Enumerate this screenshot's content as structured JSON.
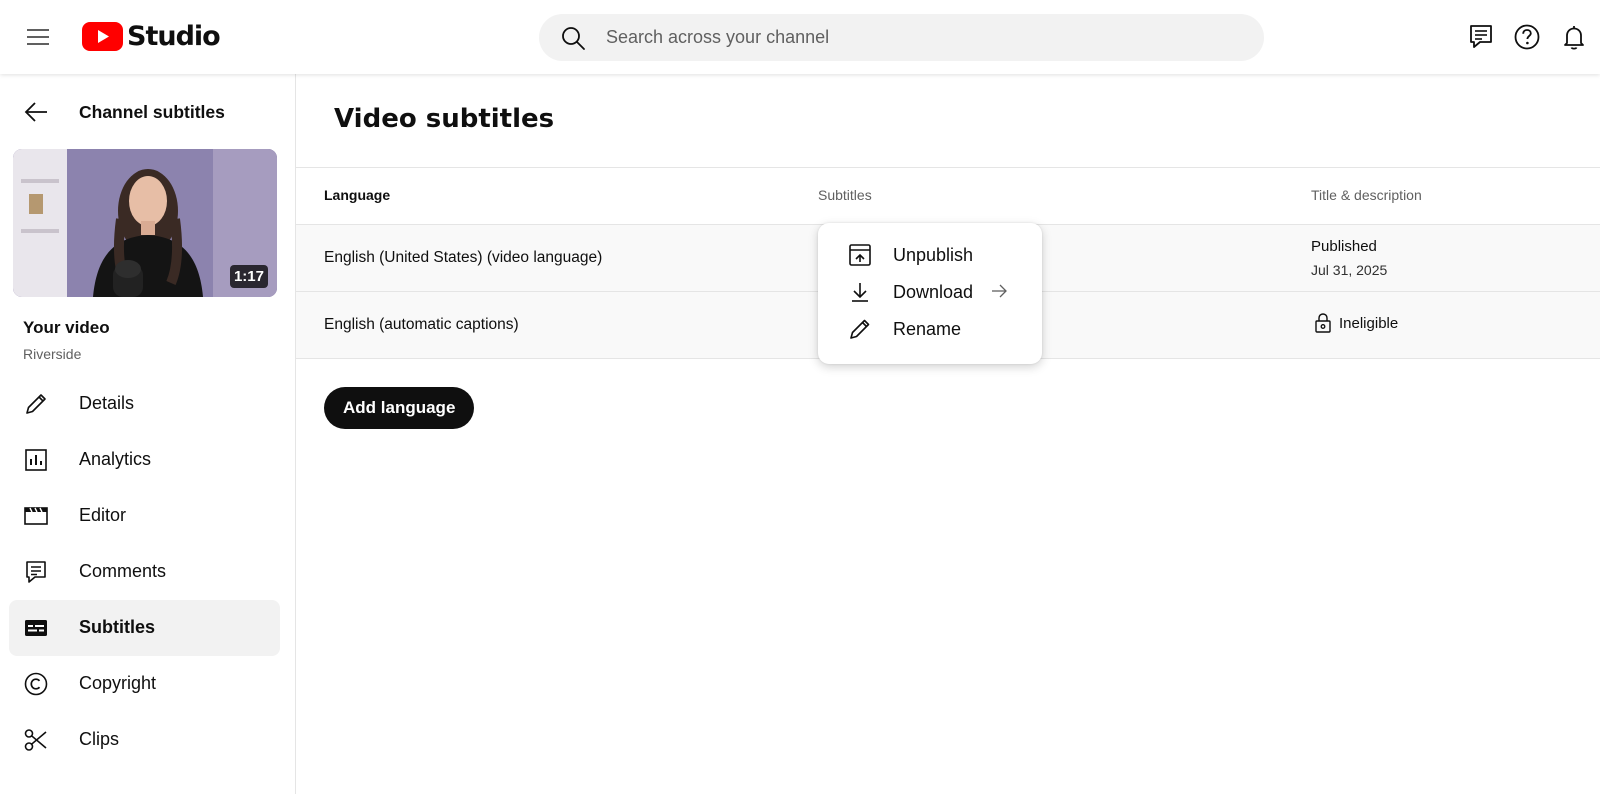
{
  "header": {
    "logo_text": "Studio",
    "search_placeholder": "Search across your channel",
    "icons": [
      "menu-icon",
      "youtube-logo-icon",
      "search-icon",
      "feedback-icon",
      "help-icon",
      "notifications-icon"
    ]
  },
  "sidebar": {
    "back_label": "Channel subtitles",
    "video": {
      "duration": "1:17",
      "title": "Your video",
      "channel": "Riverside"
    },
    "items": [
      {
        "label": "Details",
        "icon": "pencil-icon"
      },
      {
        "label": "Analytics",
        "icon": "analytics-icon"
      },
      {
        "label": "Editor",
        "icon": "clapperboard-icon"
      },
      {
        "label": "Comments",
        "icon": "comments-icon"
      },
      {
        "label": "Subtitles",
        "icon": "subtitles-icon",
        "active": true
      },
      {
        "label": "Copyright",
        "icon": "copyright-icon"
      },
      {
        "label": "Clips",
        "icon": "scissors-icon"
      }
    ]
  },
  "main": {
    "title": "Video subtitles",
    "columns": {
      "language": "Language",
      "subtitles": "Subtitles",
      "title_description": "Title & description"
    },
    "rows": [
      {
        "language": "English (United States) (video language)",
        "status": "Published",
        "date": "Jul 31, 2025"
      },
      {
        "language": "English (automatic captions)",
        "status": "Ineligible",
        "status_icon": "lock-icon"
      }
    ],
    "add_button": "Add language"
  },
  "menu": {
    "items": [
      {
        "label": "Unpublish",
        "icon": "unpublish-icon"
      },
      {
        "label": "Download",
        "icon": "download-icon",
        "has_submenu": true
      },
      {
        "label": "Rename",
        "icon": "pencil-icon"
      }
    ]
  },
  "colors": {
    "brand_red": "#ff0000",
    "text_primary": "#0f0f0f",
    "text_secondary": "#606060",
    "button_dark": "#0f0f0f",
    "row_background": "#f9f9f9",
    "active_nav_background": "#f2f2f2"
  }
}
